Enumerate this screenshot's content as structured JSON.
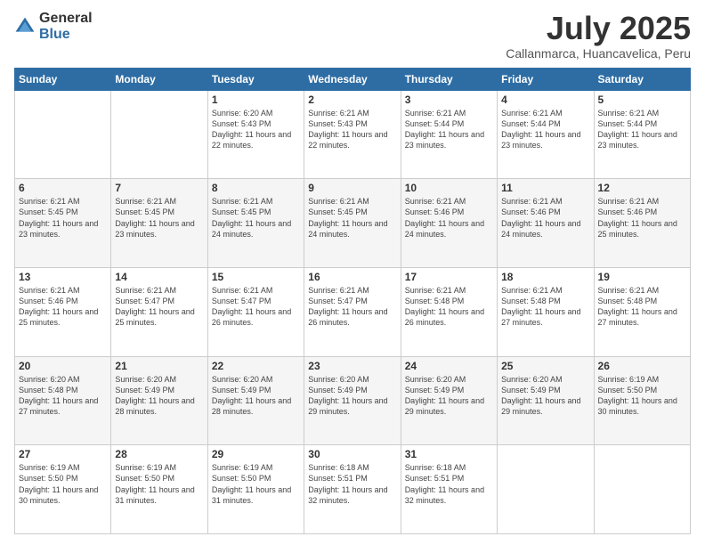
{
  "logo": {
    "general": "General",
    "blue": "Blue"
  },
  "header": {
    "title": "July 2025",
    "subtitle": "Callanmarca, Huancavelica, Peru"
  },
  "weekdays": [
    "Sunday",
    "Monday",
    "Tuesday",
    "Wednesday",
    "Thursday",
    "Friday",
    "Saturday"
  ],
  "weeks": [
    [
      {
        "day": "",
        "info": ""
      },
      {
        "day": "",
        "info": ""
      },
      {
        "day": "1",
        "info": "Sunrise: 6:20 AM\nSunset: 5:43 PM\nDaylight: 11 hours and 22 minutes."
      },
      {
        "day": "2",
        "info": "Sunrise: 6:21 AM\nSunset: 5:43 PM\nDaylight: 11 hours and 22 minutes."
      },
      {
        "day": "3",
        "info": "Sunrise: 6:21 AM\nSunset: 5:44 PM\nDaylight: 11 hours and 23 minutes."
      },
      {
        "day": "4",
        "info": "Sunrise: 6:21 AM\nSunset: 5:44 PM\nDaylight: 11 hours and 23 minutes."
      },
      {
        "day": "5",
        "info": "Sunrise: 6:21 AM\nSunset: 5:44 PM\nDaylight: 11 hours and 23 minutes."
      }
    ],
    [
      {
        "day": "6",
        "info": "Sunrise: 6:21 AM\nSunset: 5:45 PM\nDaylight: 11 hours and 23 minutes."
      },
      {
        "day": "7",
        "info": "Sunrise: 6:21 AM\nSunset: 5:45 PM\nDaylight: 11 hours and 23 minutes."
      },
      {
        "day": "8",
        "info": "Sunrise: 6:21 AM\nSunset: 5:45 PM\nDaylight: 11 hours and 24 minutes."
      },
      {
        "day": "9",
        "info": "Sunrise: 6:21 AM\nSunset: 5:45 PM\nDaylight: 11 hours and 24 minutes."
      },
      {
        "day": "10",
        "info": "Sunrise: 6:21 AM\nSunset: 5:46 PM\nDaylight: 11 hours and 24 minutes."
      },
      {
        "day": "11",
        "info": "Sunrise: 6:21 AM\nSunset: 5:46 PM\nDaylight: 11 hours and 24 minutes."
      },
      {
        "day": "12",
        "info": "Sunrise: 6:21 AM\nSunset: 5:46 PM\nDaylight: 11 hours and 25 minutes."
      }
    ],
    [
      {
        "day": "13",
        "info": "Sunrise: 6:21 AM\nSunset: 5:46 PM\nDaylight: 11 hours and 25 minutes."
      },
      {
        "day": "14",
        "info": "Sunrise: 6:21 AM\nSunset: 5:47 PM\nDaylight: 11 hours and 25 minutes."
      },
      {
        "day": "15",
        "info": "Sunrise: 6:21 AM\nSunset: 5:47 PM\nDaylight: 11 hours and 26 minutes."
      },
      {
        "day": "16",
        "info": "Sunrise: 6:21 AM\nSunset: 5:47 PM\nDaylight: 11 hours and 26 minutes."
      },
      {
        "day": "17",
        "info": "Sunrise: 6:21 AM\nSunset: 5:48 PM\nDaylight: 11 hours and 26 minutes."
      },
      {
        "day": "18",
        "info": "Sunrise: 6:21 AM\nSunset: 5:48 PM\nDaylight: 11 hours and 27 minutes."
      },
      {
        "day": "19",
        "info": "Sunrise: 6:21 AM\nSunset: 5:48 PM\nDaylight: 11 hours and 27 minutes."
      }
    ],
    [
      {
        "day": "20",
        "info": "Sunrise: 6:20 AM\nSunset: 5:48 PM\nDaylight: 11 hours and 27 minutes."
      },
      {
        "day": "21",
        "info": "Sunrise: 6:20 AM\nSunset: 5:49 PM\nDaylight: 11 hours and 28 minutes."
      },
      {
        "day": "22",
        "info": "Sunrise: 6:20 AM\nSunset: 5:49 PM\nDaylight: 11 hours and 28 minutes."
      },
      {
        "day": "23",
        "info": "Sunrise: 6:20 AM\nSunset: 5:49 PM\nDaylight: 11 hours and 29 minutes."
      },
      {
        "day": "24",
        "info": "Sunrise: 6:20 AM\nSunset: 5:49 PM\nDaylight: 11 hours and 29 minutes."
      },
      {
        "day": "25",
        "info": "Sunrise: 6:20 AM\nSunset: 5:49 PM\nDaylight: 11 hours and 29 minutes."
      },
      {
        "day": "26",
        "info": "Sunrise: 6:19 AM\nSunset: 5:50 PM\nDaylight: 11 hours and 30 minutes."
      }
    ],
    [
      {
        "day": "27",
        "info": "Sunrise: 6:19 AM\nSunset: 5:50 PM\nDaylight: 11 hours and 30 minutes."
      },
      {
        "day": "28",
        "info": "Sunrise: 6:19 AM\nSunset: 5:50 PM\nDaylight: 11 hours and 31 minutes."
      },
      {
        "day": "29",
        "info": "Sunrise: 6:19 AM\nSunset: 5:50 PM\nDaylight: 11 hours and 31 minutes."
      },
      {
        "day": "30",
        "info": "Sunrise: 6:18 AM\nSunset: 5:51 PM\nDaylight: 11 hours and 32 minutes."
      },
      {
        "day": "31",
        "info": "Sunrise: 6:18 AM\nSunset: 5:51 PM\nDaylight: 11 hours and 32 minutes."
      },
      {
        "day": "",
        "info": ""
      },
      {
        "day": "",
        "info": ""
      }
    ]
  ]
}
